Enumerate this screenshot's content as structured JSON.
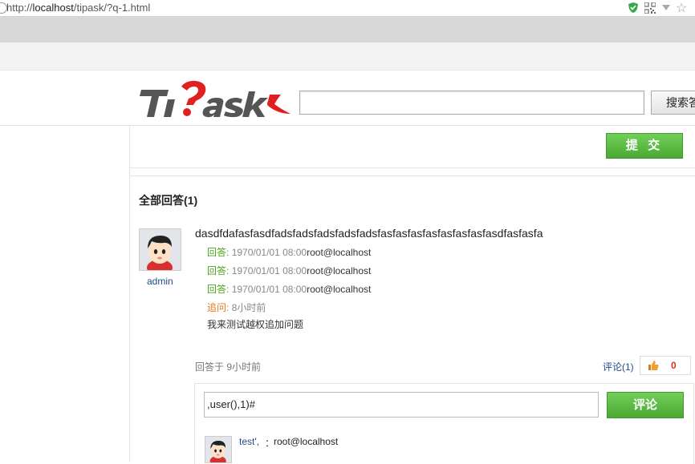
{
  "browser": {
    "url_prefix": "http://",
    "url_host": "localhost",
    "url_path": "/tipask/?q-1.html"
  },
  "header": {
    "logo_text": "Tipask",
    "search_button_label": "搜索答"
  },
  "submit_panel": {
    "submit_label": "提 交"
  },
  "answers": {
    "title": "全部回答(1)",
    "answer": {
      "username": "admin",
      "content": "dasdfdafasfasdfadsfadsfadsfadsfadsfasfasfasfasfasfasfasfasdfasfasfa",
      "replies": [
        {
          "label": "回答:",
          "time": "1970/01/01 08:00",
          "text": "root@localhost"
        },
        {
          "label": "回答:",
          "time": "1970/01/01 08:00",
          "text": "root@localhost"
        },
        {
          "label": "回答:",
          "time": "1970/01/01 08:00",
          "text": "root@localhost"
        }
      ],
      "followup": {
        "label": "追问:",
        "time": "8小时前",
        "text": "我来测试越权追加问题"
      },
      "answered_at": "回答于 9小时前",
      "comment_link": "评论(1)",
      "vote_count": "0"
    },
    "comment_box": {
      "input_value": ",user(),1)#",
      "button_label": "评论",
      "comment": {
        "user": "test',",
        "separator": "：",
        "text": "root@localhost"
      }
    }
  },
  "colors": {
    "accent_green": "#4aa833",
    "link_blue": "#1f4b8e",
    "logo_red": "#e02020",
    "logo_gray": "#555555"
  }
}
